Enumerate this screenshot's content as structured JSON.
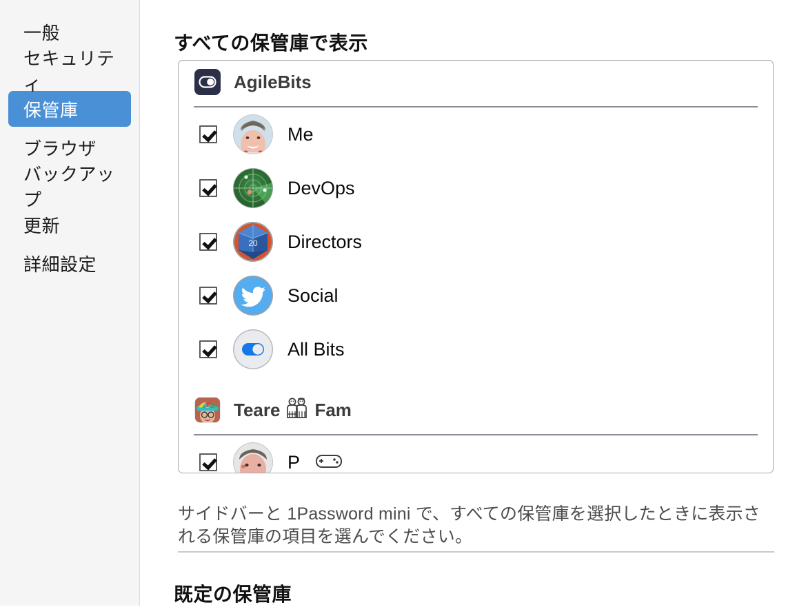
{
  "sidebar": {
    "items": [
      {
        "label": "一般",
        "name": "general",
        "selected": false
      },
      {
        "label": "セキュリティ",
        "name": "security",
        "selected": false
      },
      {
        "label": "保管庫",
        "name": "vaults",
        "selected": true
      },
      {
        "label": "ブラウザ",
        "name": "browser",
        "selected": false
      },
      {
        "label": "バックアップ",
        "name": "backup",
        "selected": false
      },
      {
        "label": "更新",
        "name": "updates",
        "selected": false
      },
      {
        "label": "詳細設定",
        "name": "advanced",
        "selected": false
      }
    ]
  },
  "main": {
    "section_title": "すべての保管庫で表示",
    "help_text": "サイドバーと 1Password mini で、すべての保管庫を選択したときに表示される保管庫の項目を選んでください。",
    "section_title_2": "既定の保管庫"
  },
  "vault_list": {
    "accounts": [
      {
        "name": "AgileBits",
        "icon": "agilebits-logo-icon",
        "vaults": [
          {
            "label": "Me",
            "checked": true,
            "icon": "avatar-photo-man"
          },
          {
            "label": "DevOps",
            "checked": true,
            "icon": "radar-icon"
          },
          {
            "label": "Directors",
            "checked": true,
            "icon": "d20-dice-icon"
          },
          {
            "label": "Social",
            "checked": true,
            "icon": "twitter-bird-icon"
          },
          {
            "label": "All Bits",
            "checked": true,
            "icon": "toggle-switch-icon"
          }
        ]
      },
      {
        "name": "Teare 👨‍👩‍👧‍👦 Fam",
        "name_prefix": "Teare",
        "name_emoji": "family-emoji",
        "name_suffix": "Fam",
        "icon": "avatar-photo-child",
        "vaults": [
          {
            "label": "P",
            "checked": true,
            "icon": "avatar-photo-man-2",
            "clipped": true
          }
        ]
      }
    ]
  },
  "colors": {
    "sidebar_selected": "#4a90d6",
    "sidebar_bg": "#f5f5f5",
    "box_border": "#a9a9b0",
    "divider": "#8c8c96",
    "help_text": "#4d4d4d"
  }
}
